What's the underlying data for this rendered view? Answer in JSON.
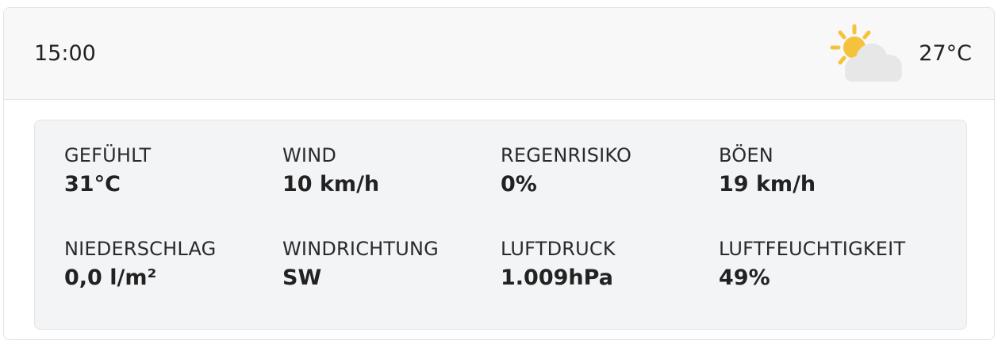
{
  "header": {
    "time": "15:00",
    "temperature": "27°C",
    "icon": "partly-sunny-icon"
  },
  "colors": {
    "sun": "#f5c33b",
    "cloud": "#e7e7e7",
    "header_bg": "#f8f8f8",
    "details_bg": "#f3f4f6"
  },
  "details": {
    "row1": [
      {
        "label": "GEFÜHLT",
        "value": "31°C"
      },
      {
        "label": "WIND",
        "value": "10 km/h"
      },
      {
        "label": "REGENRISIKO",
        "value": "0%"
      },
      {
        "label": "BÖEN",
        "value": "19 km/h"
      }
    ],
    "row2": [
      {
        "label": "NIEDERSCHLAG",
        "value": "0,0 l/m²"
      },
      {
        "label": "WINDRICHTUNG",
        "value": "SW"
      },
      {
        "label": "LUFTDRUCK",
        "value": "1.009hPa"
      },
      {
        "label": "LUFTFEUCHTIGKEIT",
        "value": "49%"
      }
    ]
  }
}
